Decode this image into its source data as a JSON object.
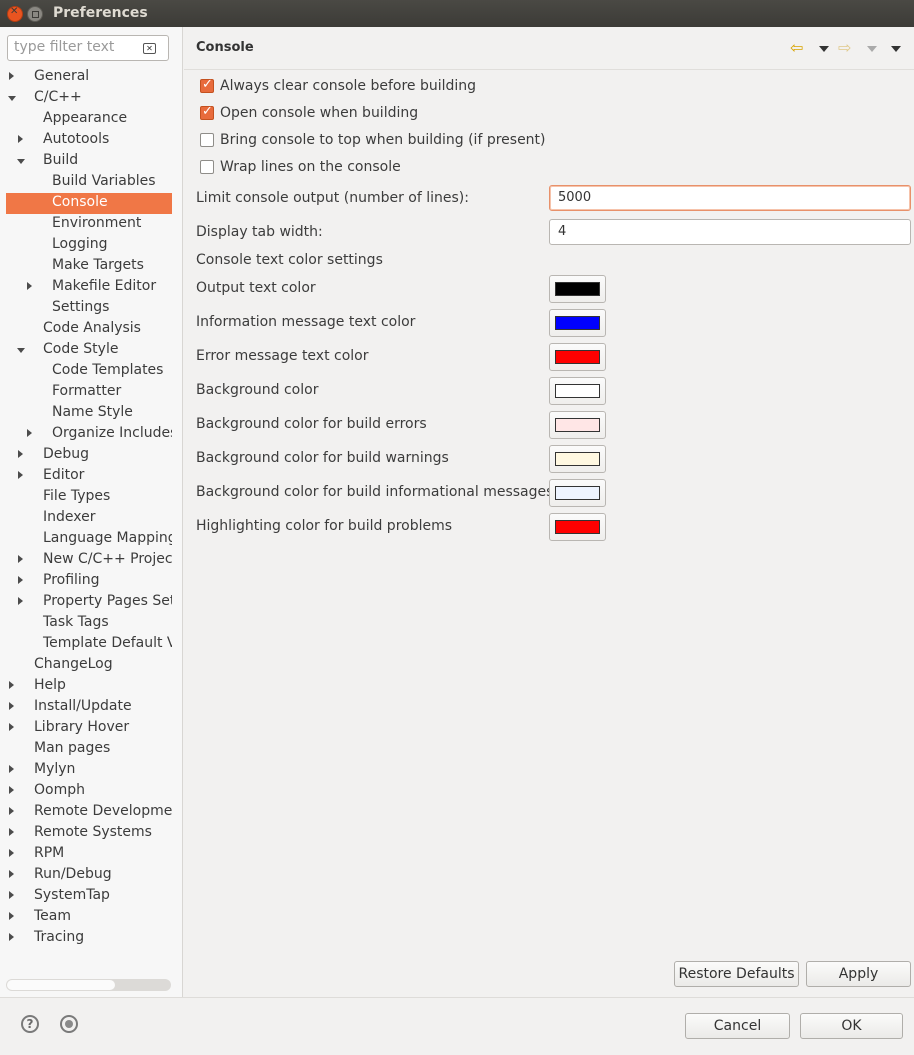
{
  "window": {
    "title": "Preferences"
  },
  "filter": {
    "placeholder": "type filter text",
    "value": ""
  },
  "tree": [
    {
      "label": "General",
      "level": 0,
      "twisty": "collapsed",
      "selected": false
    },
    {
      "label": "C/C++",
      "level": 0,
      "twisty": "expanded",
      "selected": false
    },
    {
      "label": "Appearance",
      "level": 1,
      "twisty": "none",
      "selected": false
    },
    {
      "label": "Autotools",
      "level": 1,
      "twisty": "collapsed",
      "selected": false
    },
    {
      "label": "Build",
      "level": 1,
      "twisty": "expanded",
      "selected": false
    },
    {
      "label": "Build Variables",
      "level": 2,
      "twisty": "none",
      "selected": false
    },
    {
      "label": "Console",
      "level": 2,
      "twisty": "none",
      "selected": true
    },
    {
      "label": "Environment",
      "level": 2,
      "twisty": "none",
      "selected": false
    },
    {
      "label": "Logging",
      "level": 2,
      "twisty": "none",
      "selected": false
    },
    {
      "label": "Make Targets",
      "level": 2,
      "twisty": "none",
      "selected": false
    },
    {
      "label": "Makefile Editor",
      "level": 2,
      "twisty": "collapsed",
      "selected": false
    },
    {
      "label": "Settings",
      "level": 2,
      "twisty": "none",
      "selected": false
    },
    {
      "label": "Code Analysis",
      "level": 1,
      "twisty": "none",
      "selected": false
    },
    {
      "label": "Code Style",
      "level": 1,
      "twisty": "expanded",
      "selected": false
    },
    {
      "label": "Code Templates",
      "level": 2,
      "twisty": "none",
      "selected": false
    },
    {
      "label": "Formatter",
      "level": 2,
      "twisty": "none",
      "selected": false
    },
    {
      "label": "Name Style",
      "level": 2,
      "twisty": "none",
      "selected": false
    },
    {
      "label": "Organize Includes",
      "level": 2,
      "twisty": "collapsed",
      "selected": false
    },
    {
      "label": "Debug",
      "level": 1,
      "twisty": "collapsed",
      "selected": false
    },
    {
      "label": "Editor",
      "level": 1,
      "twisty": "collapsed",
      "selected": false
    },
    {
      "label": "File Types",
      "level": 1,
      "twisty": "none",
      "selected": false
    },
    {
      "label": "Indexer",
      "level": 1,
      "twisty": "none",
      "selected": false
    },
    {
      "label": "Language Mappings",
      "level": 1,
      "twisty": "none",
      "selected": false
    },
    {
      "label": "New C/C++ Project W",
      "level": 1,
      "twisty": "collapsed",
      "selected": false
    },
    {
      "label": "Profiling",
      "level": 1,
      "twisty": "collapsed",
      "selected": false
    },
    {
      "label": "Property Pages Setti",
      "level": 1,
      "twisty": "collapsed",
      "selected": false
    },
    {
      "label": "Task Tags",
      "level": 1,
      "twisty": "none",
      "selected": false
    },
    {
      "label": "Template Default V",
      "level": 1,
      "twisty": "none",
      "selected": false
    },
    {
      "label": "ChangeLog",
      "level": 0,
      "twisty": "none",
      "selected": false
    },
    {
      "label": "Help",
      "level": 0,
      "twisty": "collapsed",
      "selected": false
    },
    {
      "label": "Install/Update",
      "level": 0,
      "twisty": "collapsed",
      "selected": false
    },
    {
      "label": "Library Hover",
      "level": 0,
      "twisty": "collapsed",
      "selected": false
    },
    {
      "label": "Man pages",
      "level": 0,
      "twisty": "none",
      "selected": false
    },
    {
      "label": "Mylyn",
      "level": 0,
      "twisty": "collapsed",
      "selected": false
    },
    {
      "label": "Oomph",
      "level": 0,
      "twisty": "collapsed",
      "selected": false
    },
    {
      "label": "Remote Development",
      "level": 0,
      "twisty": "collapsed",
      "selected": false
    },
    {
      "label": "Remote Systems",
      "level": 0,
      "twisty": "collapsed",
      "selected": false
    },
    {
      "label": "RPM",
      "level": 0,
      "twisty": "collapsed",
      "selected": false
    },
    {
      "label": "Run/Debug",
      "level": 0,
      "twisty": "collapsed",
      "selected": false
    },
    {
      "label": "SystemTap",
      "level": 0,
      "twisty": "collapsed",
      "selected": false
    },
    {
      "label": "Team",
      "level": 0,
      "twisty": "collapsed",
      "selected": false
    },
    {
      "label": "Tracing",
      "level": 0,
      "twisty": "collapsed",
      "selected": false
    }
  ],
  "page": {
    "title": "Console",
    "icons": {
      "back": "back-arrow-icon",
      "forward": "forward-arrow-icon",
      "menu": "view-menu-icon"
    }
  },
  "checkboxes": [
    {
      "label": "Always clear console before building",
      "checked": true
    },
    {
      "label": "Open console when building",
      "checked": true
    },
    {
      "label": "Bring console to top when building (if present)",
      "checked": false
    },
    {
      "label": "Wrap lines on the console",
      "checked": false
    }
  ],
  "fields": {
    "limit_label": "Limit console output (number of lines):",
    "limit_value": "5000",
    "tab_label": "Display tab width:",
    "tab_value": "4"
  },
  "colors_heading": "Console text color settings",
  "colors": [
    {
      "label": "Output text color",
      "color": "#000000"
    },
    {
      "label": "Information message text color",
      "color": "#0000ff"
    },
    {
      "label": "Error message text color",
      "color": "#ff0000"
    },
    {
      "label": "Background color",
      "color": "#ffffff"
    },
    {
      "label": "Background color for build errors",
      "color": "#ffe6e6"
    },
    {
      "label": "Background color for build warnings",
      "color": "#fff8e1"
    },
    {
      "label": "Background color for build informational messages",
      "color": "#eef4ff"
    },
    {
      "label": "Highlighting color for build problems",
      "color": "#ff0000"
    }
  ],
  "buttons": {
    "restore_defaults": "Restore Defaults",
    "apply": "Apply",
    "cancel": "Cancel",
    "ok": "OK"
  },
  "accent_color": "#f07746"
}
